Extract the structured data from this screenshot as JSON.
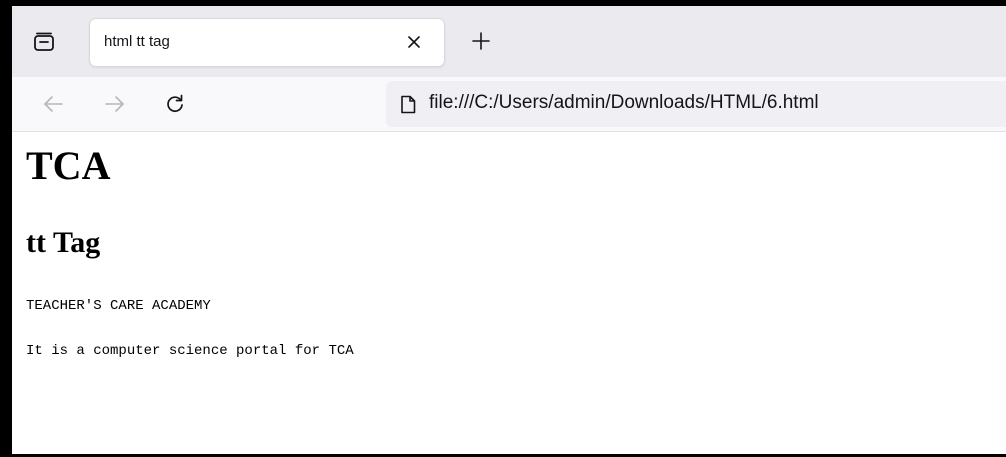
{
  "tab": {
    "title": "html tt tag"
  },
  "address_bar": {
    "url": "file:///C:/Users/admin/Downloads/HTML/6.html"
  },
  "page": {
    "heading1": "TCA",
    "heading2": "tt Tag",
    "paragraph1": "TEACHER'S CARE ACADEMY",
    "paragraph2": "It is a computer science portal for TCA"
  },
  "icons": {
    "tab_overview": "tab-overview-icon",
    "close": "close-icon",
    "new_tab": "plus-icon",
    "back": "back-arrow-icon",
    "forward": "forward-arrow-icon",
    "reload": "reload-icon",
    "page": "page-icon"
  },
  "colors": {
    "tabstrip_bg": "#ebebef",
    "toolbar_bg": "#f9f9fb",
    "urlbar_bg": "#f0f0f4",
    "text": "#15141a"
  }
}
